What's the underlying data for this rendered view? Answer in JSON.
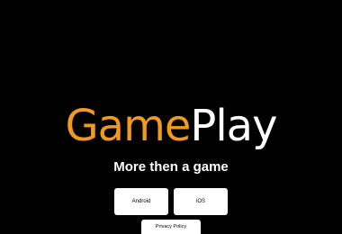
{
  "logo": {
    "part1": "Game",
    "part2": "Play",
    "colors": {
      "part1": "#f29a1d",
      "part2": "#ffffff"
    }
  },
  "tagline": "More then a game",
  "buttons": {
    "android": "Android",
    "ios": "iOS",
    "privacy": "Privacy Policy"
  },
  "colors": {
    "background": "#000000",
    "button_bg": "#ffffff",
    "button_text": "#000000"
  }
}
